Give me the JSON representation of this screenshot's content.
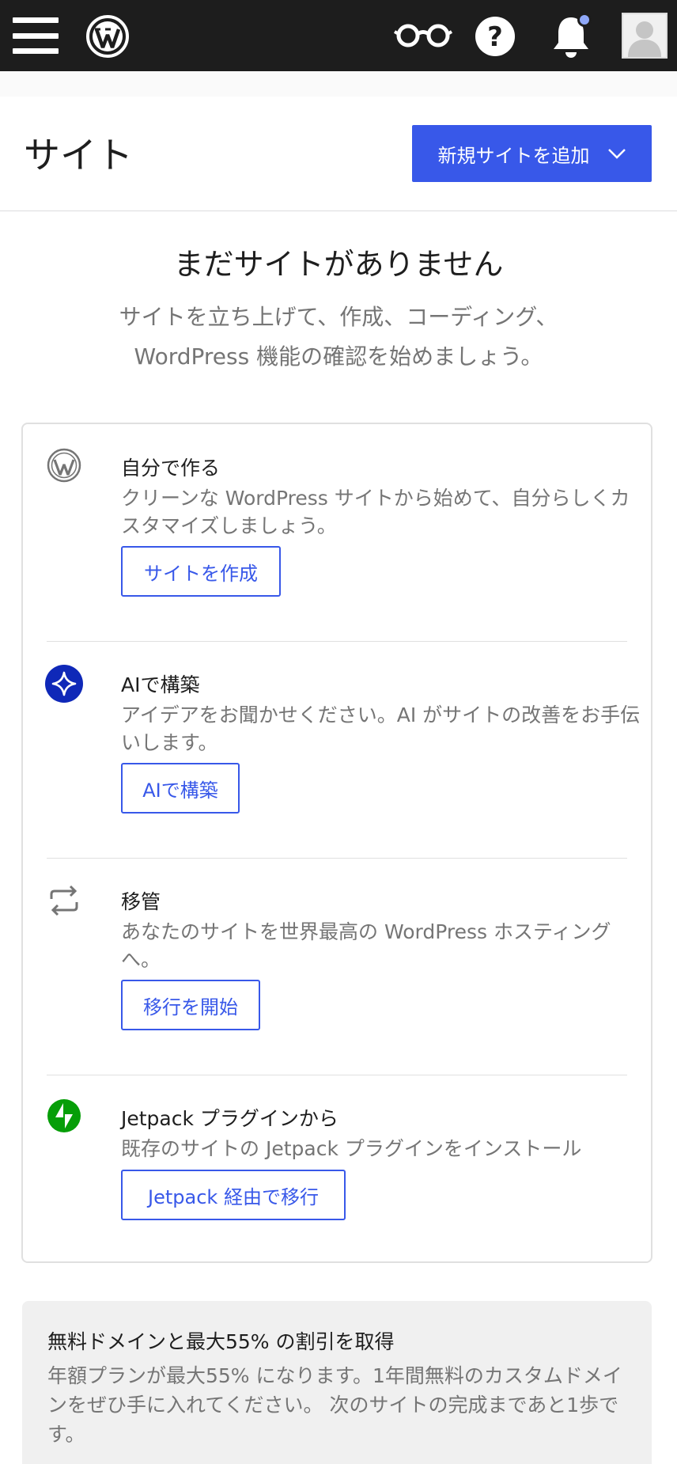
{
  "masterbar": {
    "icons": {
      "menu": "hamburger-icon",
      "logo": "wordpress-logo-icon",
      "reader": "reader-glasses-icon",
      "help": "help-icon",
      "notifications": "bell-icon",
      "profile": "avatar-icon"
    },
    "notification_dot_color": "#8fa8f8"
  },
  "header": {
    "title": "サイト",
    "add_site_label": "新規サイトを追加",
    "accent_color": "#3858e9"
  },
  "empty_state": {
    "title": "まだサイトがありません",
    "description": "サイトを立ち上げて、作成、コーディング、WordPress 機能の確認を始めましょう。"
  },
  "options": [
    {
      "icon": "wordpress-icon",
      "title": "自分で作る",
      "description": "クリーンな WordPress サイトから始めて、自分らしくカスタマイズしましょう。",
      "button": "サイトを作成"
    },
    {
      "icon": "ai-sparkle-icon",
      "title": "AIで構築",
      "description": "アイデアをお聞かせください。AI がサイトの改善をお手伝いします。",
      "button": "AIで構築"
    },
    {
      "icon": "migrate-arrows-icon",
      "title": "移管",
      "description": "あなたのサイトを世界最高の WordPress ホスティングへ。",
      "button": "移行を開始"
    },
    {
      "icon": "jetpack-icon",
      "title": "Jetpack プラグインから",
      "description": "既存のサイトの Jetpack プラグインをインストール",
      "button": "Jetpack 経由で移行"
    }
  ],
  "promo": {
    "title": "無料ドメインと最大55% の割引を取得",
    "description": "年額プランが最大55% になります。1年間無料のカスタムドメインをぜひ手に入れてください。 次のサイトの完成まであと1歩です。"
  }
}
